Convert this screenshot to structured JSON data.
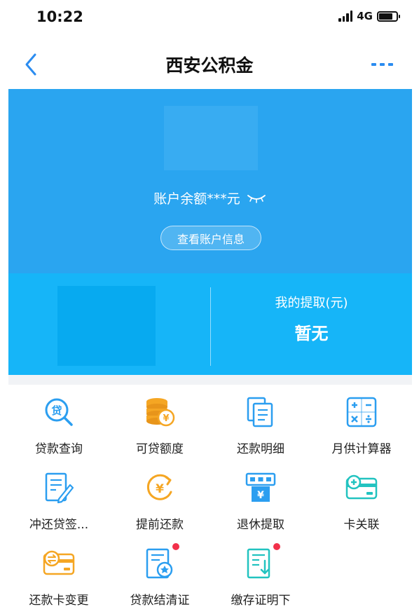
{
  "status_bar": {
    "time": "10:22",
    "network": "4G"
  },
  "nav": {
    "title": "西安公积金"
  },
  "hero": {
    "balance_text": "账户余额***元",
    "account_button": "查看账户信息"
  },
  "summary": {
    "withdraw_label": "我的提取(元)",
    "withdraw_value": "暂无"
  },
  "colors": {
    "accent": "#2aa5f0",
    "summary": "#16b5f8",
    "icon_blue": "#2b9ef0",
    "icon_orange": "#f5a623",
    "icon_teal": "#22c3c0",
    "dot_red": "#f2304a"
  },
  "services": [
    {
      "label": "贷款查询",
      "icon": "loan-search-icon"
    },
    {
      "label": "可贷额度",
      "icon": "coin-stack-icon"
    },
    {
      "label": "还款明细",
      "icon": "documents-icon"
    },
    {
      "label": "月供计算器",
      "icon": "calculator-icon"
    },
    {
      "label": "冲还贷签...",
      "icon": "sign-document-icon"
    },
    {
      "label": "提前还款",
      "icon": "early-repay-icon"
    },
    {
      "label": "退休提取",
      "icon": "atm-icon"
    },
    {
      "label": "卡关联",
      "icon": "card-link-icon"
    },
    {
      "label": "还款卡变更",
      "icon": "card-change-icon"
    },
    {
      "label": "贷款结清证",
      "icon": "certificate-icon"
    },
    {
      "label": "缴存证明下",
      "icon": "download-doc-icon"
    }
  ]
}
